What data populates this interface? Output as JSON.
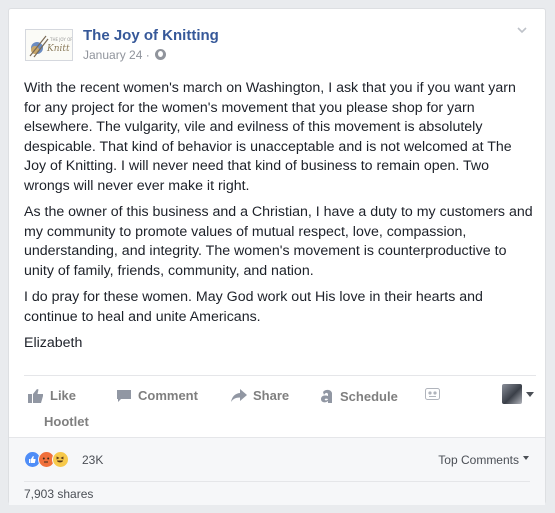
{
  "post": {
    "page_name": "The Joy of Knitting",
    "logo_text": "The Joy of Knitting",
    "date": "January 24 · ",
    "privacy_icon": "globe-icon",
    "menu_icon": "chevron-down-icon",
    "paragraphs": [
      "With the recent women's march on Washington, I ask that you if you want yarn for any project for the women's movement that you please shop for yarn elsewhere. The vulgarity, vile and evilness of this movement is absolutely despicable. That kind of behavior is unacceptable and is not welcomed at The Joy of Knitting. I will never need that kind of business to remain open. Two wrongs will never ever make it right.",
      "As the owner of this business and a Christian, I have a duty to my customers and my community to promote values of mutual respect, love, compassion, understanding, and integrity. The women's movement is counterproductive to unity of family, friends, community, and nation.",
      "I do pray for these women. May God work out His love in their hearts and continue to heal and unite Americans.",
      "Elizabeth"
    ]
  },
  "actions": {
    "like": "Like",
    "comment": "Comment",
    "share": "Share",
    "schedule": "Schedule",
    "hootlet": "Hootlet"
  },
  "reactions": {
    "icons": [
      "like-reaction",
      "angry-reaction",
      "haha-reaction"
    ],
    "count": "23K"
  },
  "top_comments": "Top Comments",
  "shares": "7,903 shares",
  "colors": {
    "link_blue": "#365899",
    "muted_text": "#90949c",
    "action_gray": "#7f7f7f",
    "bar_bg": "#f6f7f9"
  }
}
